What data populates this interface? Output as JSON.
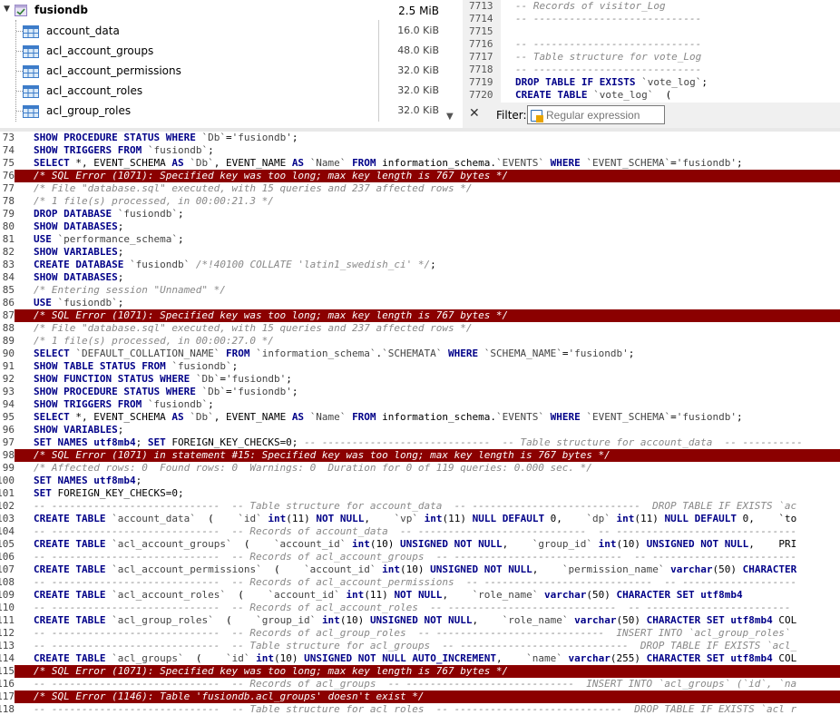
{
  "tree": {
    "database": {
      "name": "fusiondb",
      "size": "2.5 MiB"
    },
    "tables": [
      {
        "name": "account_data",
        "size": "16.0 KiB"
      },
      {
        "name": "acl_account_groups",
        "size": "48.0 KiB"
      },
      {
        "name": "acl_account_permissions",
        "size": "32.0 KiB"
      },
      {
        "name": "acl_account_roles",
        "size": "32.0 KiB"
      },
      {
        "name": "acl_group_roles",
        "size": "32.0 KiB"
      }
    ]
  },
  "preview": {
    "lines": [
      {
        "num": "7713",
        "text": "-- Records of visitor_Log",
        "kind": "comment"
      },
      {
        "num": "7714",
        "text": "-- ----------------------------",
        "kind": "comment"
      },
      {
        "num": "7715",
        "text": "",
        "kind": "plain"
      },
      {
        "num": "7716",
        "text": "-- ----------------------------",
        "kind": "comment"
      },
      {
        "num": "7717",
        "text": "-- Table structure for vote_Log",
        "kind": "comment"
      },
      {
        "num": "7718",
        "text": "-- ----------------------------",
        "kind": "comment"
      },
      {
        "num": "7719",
        "text": "DROP TABLE IF EXISTS `vote_log`;",
        "kind": "sql"
      },
      {
        "num": "7720",
        "text": "CREATE TABLE `vote_log`  (",
        "kind": "sql"
      }
    ]
  },
  "filter": {
    "label": "Filter:",
    "placeholder": "Regular expression",
    "close": "✕"
  },
  "log": {
    "lines": [
      {
        "num": "73",
        "text": "SHOW PROCEDURE STATUS WHERE `Db`='fusiondb';",
        "kind": "sql"
      },
      {
        "num": "74",
        "text": "SHOW TRIGGERS FROM `fusiondb`;",
        "kind": "sql"
      },
      {
        "num": "75",
        "text": "SELECT *, EVENT_SCHEMA AS `Db`, EVENT_NAME AS `Name` FROM information_schema.`EVENTS` WHERE `EVENT_SCHEMA`='fusiondb';",
        "kind": "sql"
      },
      {
        "num": "76",
        "text": "/* SQL Error (1071): Specified key was too long; max key length is 767 bytes */",
        "kind": "error"
      },
      {
        "num": "77",
        "text": "/* File \"database.sql\" executed, with 15 queries and 237 affected rows */",
        "kind": "comment"
      },
      {
        "num": "78",
        "text": "/* 1 file(s) processed, in 00:00:21.3 */",
        "kind": "comment"
      },
      {
        "num": "79",
        "text": "DROP DATABASE `fusiondb`;",
        "kind": "sql"
      },
      {
        "num": "80",
        "text": "SHOW DATABASES;",
        "kind": "sql"
      },
      {
        "num": "81",
        "text": "USE `performance_schema`;",
        "kind": "sql"
      },
      {
        "num": "82",
        "text": "SHOW VARIABLES;",
        "kind": "sql"
      },
      {
        "num": "83",
        "text": "CREATE DATABASE `fusiondb` /*!40100 COLLATE 'latin1_swedish_ci' */;",
        "kind": "sql"
      },
      {
        "num": "84",
        "text": "SHOW DATABASES;",
        "kind": "sql"
      },
      {
        "num": "85",
        "text": "/* Entering session \"Unnamed\" */",
        "kind": "comment"
      },
      {
        "num": "86",
        "text": "USE `fusiondb`;",
        "kind": "sql"
      },
      {
        "num": "87",
        "text": "/* SQL Error (1071): Specified key was too long; max key length is 767 bytes */",
        "kind": "error"
      },
      {
        "num": "88",
        "text": "/* File \"database.sql\" executed, with 15 queries and 237 affected rows */",
        "kind": "comment"
      },
      {
        "num": "89",
        "text": "/* 1 file(s) processed, in 00:00:27.0 */",
        "kind": "comment"
      },
      {
        "num": "90",
        "text": "SELECT `DEFAULT_COLLATION_NAME` FROM `information_schema`.`SCHEMATA` WHERE `SCHEMA_NAME`='fusiondb';",
        "kind": "sql"
      },
      {
        "num": "91",
        "text": "SHOW TABLE STATUS FROM `fusiondb`;",
        "kind": "sql"
      },
      {
        "num": "92",
        "text": "SHOW FUNCTION STATUS WHERE `Db`='fusiondb';",
        "kind": "sql"
      },
      {
        "num": "93",
        "text": "SHOW PROCEDURE STATUS WHERE `Db`='fusiondb';",
        "kind": "sql"
      },
      {
        "num": "94",
        "text": "SHOW TRIGGERS FROM `fusiondb`;",
        "kind": "sql"
      },
      {
        "num": "95",
        "text": "SELECT *, EVENT_SCHEMA AS `Db`, EVENT_NAME AS `Name` FROM information_schema.`EVENTS` WHERE `EVENT_SCHEMA`='fusiondb';",
        "kind": "sql"
      },
      {
        "num": "96",
        "text": "SHOW VARIABLES;",
        "kind": "sql"
      },
      {
        "num": "97",
        "text": "SET NAMES utf8mb4; SET FOREIGN_KEY_CHECKS=0; -- ----------------------------  -- Table structure for account_data  -- ----------",
        "kind": "sql"
      },
      {
        "num": "98",
        "text": "/* SQL Error (1071) in statement #15: Specified key was too long; max key length is 767 bytes */",
        "kind": "error"
      },
      {
        "num": "99",
        "text": "/* Affected rows: 0  Found rows: 0  Warnings: 0  Duration for 0 of 119 queries: 0.000 sec. */",
        "kind": "comment"
      },
      {
        "num": "100",
        "text": "SET NAMES utf8mb4;",
        "kind": "sql"
      },
      {
        "num": "101",
        "text": "SET FOREIGN_KEY_CHECKS=0;",
        "kind": "sql"
      },
      {
        "num": "102",
        "text": "-- ----------------------------  -- Table structure for account_data  -- ----------------------------  DROP TABLE IF EXISTS `ac",
        "kind": "sql"
      },
      {
        "num": "103",
        "text": "CREATE TABLE `account_data`  (    `id` int(11) NOT NULL,    `vp` int(11) NULL DEFAULT 0,    `dp` int(11) NULL DEFAULT 0,    `to",
        "kind": "sql"
      },
      {
        "num": "104",
        "text": "-- ----------------------------  -- Records of account_data  -- ----------------------------  -- ------------------------------",
        "kind": "comment"
      },
      {
        "num": "105",
        "text": "CREATE TABLE `acl_account_groups`  (    `account_id` int(10) UNSIGNED NOT NULL,    `group_id` int(10) UNSIGNED NOT NULL,    PRI",
        "kind": "sql"
      },
      {
        "num": "106",
        "text": "-- ----------------------------  -- Records of acl_account_groups  -- ----------------------------  -- ------------------------",
        "kind": "comment"
      },
      {
        "num": "107",
        "text": "CREATE TABLE `acl_account_permissions`  (    `account_id` int(10) UNSIGNED NOT NULL,    `permission_name` varchar(50) CHARACTER",
        "kind": "sql"
      },
      {
        "num": "108",
        "text": "-- ----------------------------  -- Records of acl_account_permissions  -- ----------------------------  -- -------------------",
        "kind": "comment"
      },
      {
        "num": "109",
        "text": "CREATE TABLE `acl_account_roles`  (    `account_id` int(11) NOT NULL,    `role_name` varchar(50) CHARACTER SET utf8mb4",
        "kind": "sql"
      },
      {
        "num": "110",
        "text": "-- ----------------------------  -- Records of acl_account_roles  -- ----------------------------  -- ------------------------",
        "kind": "comment"
      },
      {
        "num": "111",
        "text": "CREATE TABLE `acl_group_roles`  (    `group_id` int(10) UNSIGNED NOT NULL,    `role_name` varchar(50) CHARACTER SET utf8mb4 COL",
        "kind": "sql"
      },
      {
        "num": "112",
        "text": "-- ----------------------------  -- Records of acl_group_roles  -- ----------------------------  INSERT INTO `acl_group_roles`",
        "kind": "sql"
      },
      {
        "num": "113",
        "text": "-- ----------------------------  -- Table structure for acl_groups  -- ----------------------------  DROP TABLE IF EXISTS `acl_",
        "kind": "sql"
      },
      {
        "num": "114",
        "text": "CREATE TABLE `acl_groups`  (    `id` int(10) UNSIGNED NOT NULL AUTO_INCREMENT,    `name` varchar(255) CHARACTER SET utf8mb4 COL",
        "kind": "sql"
      },
      {
        "num": "115",
        "text": "/* SQL Error (1071): Specified key was too long; max key length is 767 bytes */",
        "kind": "error"
      },
      {
        "num": "116",
        "text": "-- ----------------------------  -- Records of acl_groups  -- ----------------------------  INSERT INTO `acl_groups` (`id`, `na",
        "kind": "sql"
      },
      {
        "num": "117",
        "text": "/* SQL Error (1146): Table 'fusiondb.acl_groups' doesn't exist */",
        "kind": "error"
      },
      {
        "num": "118",
        "text": "-- ----------------------------  -- Table structure for acl roles  -- ----------------------------  DROP TABLE IF EXISTS `acl r",
        "kind": "sql"
      }
    ]
  },
  "colors": {
    "error_bg": "#8b0000",
    "keyword": "#000088",
    "comment": "#888888"
  }
}
